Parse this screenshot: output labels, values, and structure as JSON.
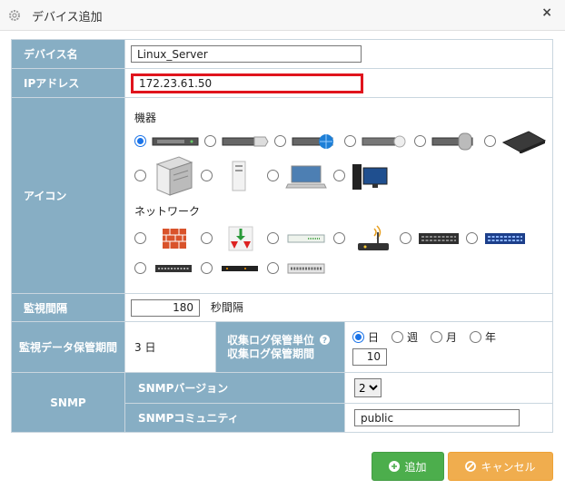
{
  "dialog": {
    "title": "デバイス追加",
    "close_label": "×"
  },
  "form": {
    "device_name": {
      "label": "デバイス名",
      "value": "Linux_Server"
    },
    "ip_address": {
      "label": "IPアドレス",
      "value": "172.23.61.50"
    },
    "icon": {
      "label": "アイコン",
      "devices_title": "機器",
      "network_title": "ネットワーク",
      "device_icons": [
        "rack-server-icon",
        "rack-server-disk-icon",
        "rack-server-globe-icon",
        "rack-server-db-icon",
        "rack-server-cylinder-icon",
        "network-appliance-icon",
        "tower-server-icon",
        "pc-tower-icon",
        "laptop-icon",
        "desktop-pc-icon"
      ],
      "network_icons": [
        "firewall-icon",
        "router-arrows-icon",
        "hub-icon",
        "wireless-router-icon",
        "switch-black-icon",
        "switch-blue-icon",
        "small-switch-icon",
        "modem-icon",
        "patch-panel-icon"
      ],
      "selected": 0
    },
    "monitor_interval": {
      "label": "監視間隔",
      "value": "180",
      "unit": "秒間隔"
    },
    "data_retention": {
      "label": "監視データ保管期間",
      "value": "3 日"
    },
    "log_retention": {
      "label_line1": "収集ログ保管単位",
      "label_line2": "収集ログ保管期間",
      "help_icon": "question-circle-icon",
      "options": [
        "日",
        "週",
        "月",
        "年"
      ],
      "selected": "日",
      "value": "10"
    },
    "snmp": {
      "label": "SNMP",
      "version_label": "SNMPバージョン",
      "version_value": "2",
      "community_label": "SNMPコミュニティ",
      "community_value": "public"
    }
  },
  "buttons": {
    "add_label": "追加",
    "cancel_label": "キャンセル"
  },
  "colors": {
    "label_bg": "#87aec4",
    "add": "#4cae4c",
    "cancel": "#f0ad4e",
    "ip_highlight": "#e0141d",
    "radio_on": "#1a73e8"
  }
}
